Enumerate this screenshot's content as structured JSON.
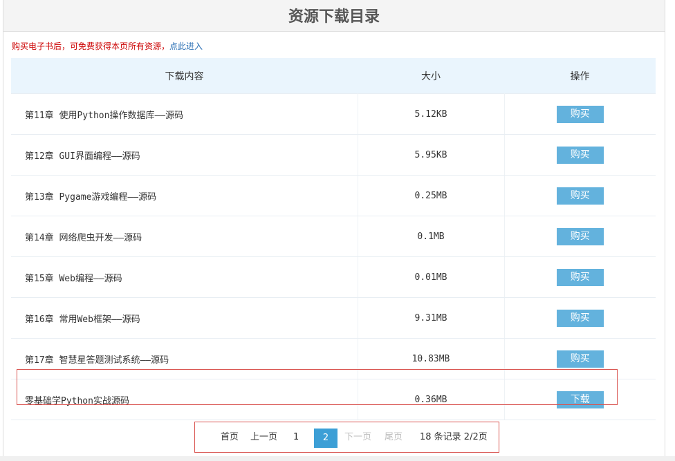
{
  "page": {
    "title": "资源下载目录",
    "notice_text": "购买电子书后，可免费获得本页所有资源，",
    "notice_link": "点此进入"
  },
  "table": {
    "headers": {
      "name": "下载内容",
      "size": "大小",
      "action": "操作"
    },
    "rows": [
      {
        "name": "第11章 使用Python操作数据库——源码",
        "size": "5.12KB",
        "action": "购买"
      },
      {
        "name": "第12章 GUI界面编程——源码",
        "size": "5.95KB",
        "action": "购买"
      },
      {
        "name": "第13章 Pygame游戏编程——源码",
        "size": "0.25MB",
        "action": "购买"
      },
      {
        "name": "第14章 网络爬虫开发——源码",
        "size": "0.1MB",
        "action": "购买"
      },
      {
        "name": "第15章 Web编程——源码",
        "size": "0.01MB",
        "action": "购买"
      },
      {
        "name": "第16章 常用Web框架——源码",
        "size": "9.31MB",
        "action": "购买"
      },
      {
        "name": "第17章 智慧星答题测试系统——源码",
        "size": "10.83MB",
        "action": "购买"
      },
      {
        "name": "零基础学Python实战源码",
        "size": "0.36MB",
        "action": "下载"
      }
    ]
  },
  "pagination": {
    "first": "首页",
    "prev": "上一页",
    "page1": "1",
    "page2": "2",
    "next": "下一页",
    "last": "尾页",
    "summary": "18 条记录 2/2页"
  }
}
